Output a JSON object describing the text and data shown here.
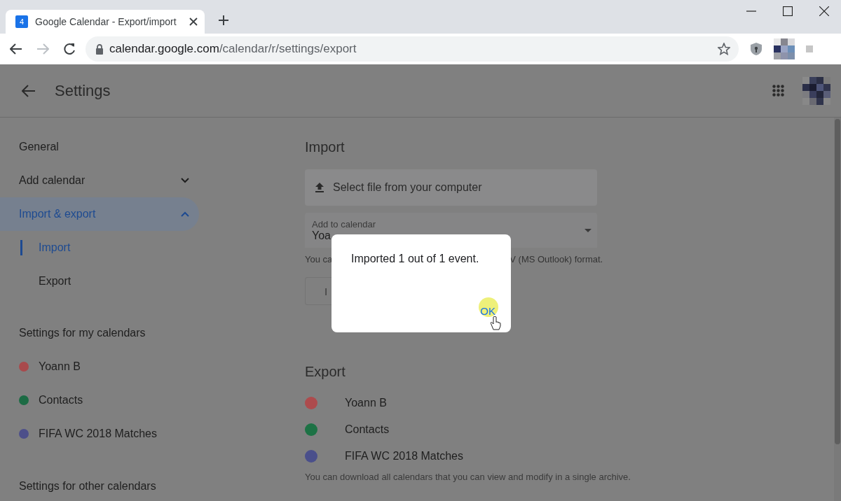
{
  "browser": {
    "tab": {
      "favicon": "4",
      "title": "Google Calendar - Export/import"
    },
    "address": {
      "host": "calendar.google.com",
      "path": "/calendar/r/settings/export"
    }
  },
  "header": {
    "title": "Settings"
  },
  "sidebar": {
    "nav": [
      {
        "label": "General",
        "selected": false
      },
      {
        "label": "Add calendar",
        "selected": false,
        "expanded": false
      },
      {
        "label": "Import & export",
        "selected": true,
        "expanded": true,
        "children": [
          {
            "label": "Import",
            "selected": true
          },
          {
            "label": "Export",
            "selected": false
          }
        ]
      }
    ],
    "sections": [
      {
        "heading": "Settings for my calendars",
        "calendars": [
          {
            "name": "Yoann B",
            "color": "#a84a4c"
          },
          {
            "name": "Contacts",
            "color": "#1c6b44"
          },
          {
            "name": "FIFA WC 2018 Matches",
            "color": "#4d4f8a"
          }
        ]
      },
      {
        "heading": "Settings for other calendars"
      }
    ]
  },
  "import": {
    "heading": "Import",
    "file_button": "Select file from your computer",
    "dropdown": {
      "label": "Add to calendar",
      "value": "Yoa"
    },
    "hint_parts": [
      "You ca",
      "V (MS Outlook) format."
    ],
    "button": "I"
  },
  "export": {
    "heading": "Export",
    "calendars": [
      {
        "name": "Yoann B",
        "color": "#ad4b4d"
      },
      {
        "name": "Contacts",
        "color": "#1d7245"
      },
      {
        "name": "FIFA WC 2018 Matches",
        "color": "#4a4f8b"
      }
    ],
    "note": "You can download all calendars that you can view and modify in a single archive."
  },
  "dialog": {
    "message": "Imported 1 out of 1 event.",
    "button": "OK"
  }
}
